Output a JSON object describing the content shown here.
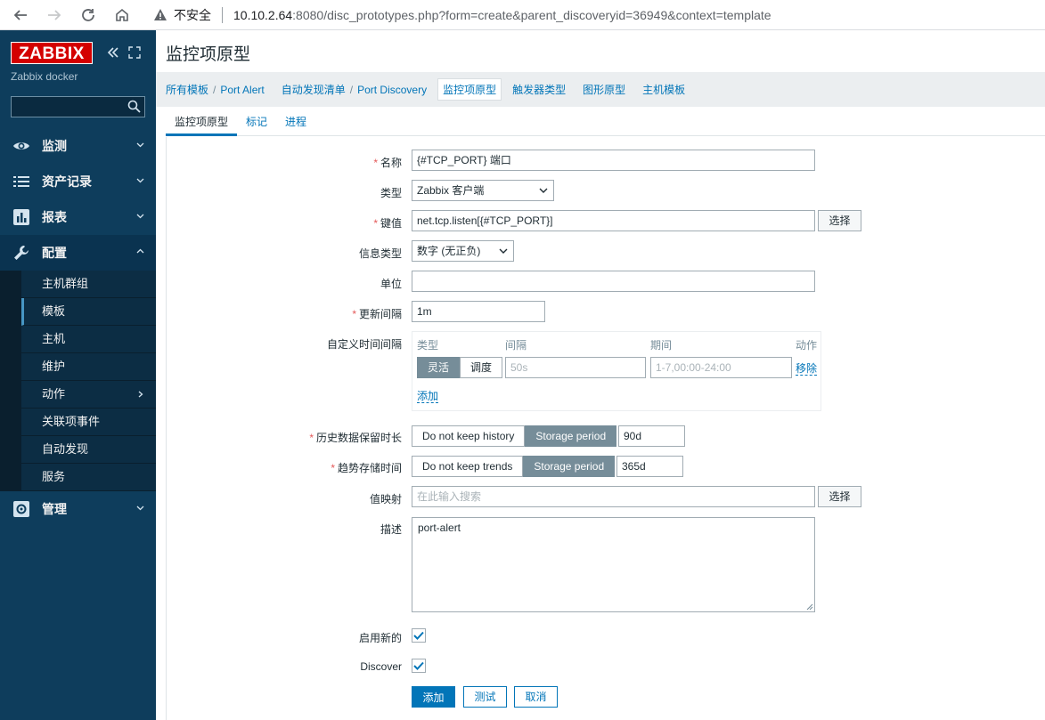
{
  "browser": {
    "security_label": "不安全",
    "url_host": "10.10.2.64",
    "url_rest": ":8080/disc_prototypes.php?form=create&parent_discoveryid=36949&context=template"
  },
  "sidebar": {
    "logo": "ZABBIX",
    "server_name": "Zabbix docker",
    "search_value": "",
    "menu": [
      {
        "label": "监测",
        "icon": "eye-icon"
      },
      {
        "label": "资产记录",
        "icon": "list-icon"
      },
      {
        "label": "报表",
        "icon": "bar-chart-icon"
      },
      {
        "label": "配置",
        "icon": "wrench-icon"
      },
      {
        "label": "管理",
        "icon": "gear-icon"
      }
    ],
    "config_submenu": [
      "主机群组",
      "模板",
      "主机",
      "维护",
      "动作",
      "关联项事件",
      "自动发现",
      "服务"
    ],
    "selected_submenu": "模板"
  },
  "page": {
    "title": "监控项原型",
    "breadcrumbs": [
      "所有模板",
      "Port Alert",
      "自动发现清单",
      "Port Discovery",
      "监控项原型",
      "触发器类型",
      "图形原型",
      "主机模板"
    ],
    "tabs": [
      "监控项原型",
      "标记",
      "进程"
    ],
    "active_tab": "监控项原型"
  },
  "form": {
    "name_label": "名称",
    "name_value": "{#TCP_PORT} 端口",
    "type_label": "类型",
    "type_value": "Zabbix 客户端",
    "key_label": "键值",
    "key_value": "net.tcp.listen[{#TCP_PORT}]",
    "select_label": "选择",
    "info_type_label": "信息类型",
    "info_type_value": "数字 (无正负)",
    "units_label": "单位",
    "units_value": "",
    "interval_label": "更新间隔",
    "interval_value": "1m",
    "custom_intervals_label": "自定义时间间隔",
    "custom_intervals": {
      "col_type": "类型",
      "col_interval": "间隔",
      "col_period": "期间",
      "col_action": "动作",
      "flexible_label": "灵活",
      "scheduling_label": "调度",
      "interval_placeholder": "50s",
      "period_placeholder": "1-7,00:00-24:00",
      "remove_label": "移除",
      "add_label": "添加"
    },
    "history_label": "历史数据保留时长",
    "history_no_keep": "Do not keep history",
    "history_storage": "Storage period",
    "history_value": "90d",
    "trends_label": "趋势存储时间",
    "trends_no_keep": "Do not keep trends",
    "trends_storage": "Storage period",
    "trends_value": "365d",
    "valuemap_label": "值映射",
    "valuemap_placeholder": "在此输入搜索",
    "description_label": "描述",
    "description_value": "port-alert",
    "enable_label": "启用新的",
    "enable_checked": true,
    "discover_label": "Discover",
    "discover_checked": true,
    "add_button": "添加",
    "test_button": "测试",
    "cancel_button": "取消"
  },
  "colors": {
    "sidebar_bg": "#0e3d5c",
    "accent": "#0275b8",
    "logo_red": "#d40000",
    "required": "#e45959"
  }
}
